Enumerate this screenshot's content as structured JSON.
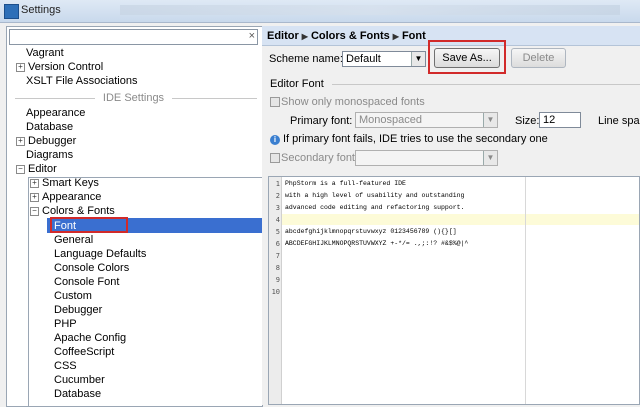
{
  "window": {
    "title": "Settings"
  },
  "search": {
    "clear_icon": "×"
  },
  "tree": {
    "top_items": [
      "Vagrant",
      "Version Control",
      "XSLT File Associations"
    ],
    "ide_section": "IDE Settings",
    "ide_items": [
      "Appearance",
      "Database",
      "Debugger",
      "Diagrams",
      "Editor"
    ],
    "editor_children": [
      "Smart Keys",
      "Appearance",
      "Colors & Fonts"
    ],
    "colors_children": [
      "Font",
      "General",
      "Language Defaults",
      "Console Colors",
      "Console Font",
      "Custom",
      "Debugger",
      "PHP",
      "Apache Config",
      "CoffeeScript",
      "CSS",
      "Cucumber",
      "Database"
    ]
  },
  "breadcrumb": [
    "Editor",
    "Colors & Fonts",
    "Font"
  ],
  "scheme": {
    "label": "Scheme name:",
    "value": "Default",
    "save_as": "Save As...",
    "delete": "Delete"
  },
  "editor_font": {
    "section": "Editor Font",
    "only_mono": "Show only monospaced fonts",
    "primary_label": "Primary font:",
    "primary_value": "Monospaced",
    "size_label": "Size:",
    "size_value": "12",
    "line_spacing": "Line spac",
    "fallback_note": "If primary font fails, IDE tries to use the secondary one",
    "secondary_label": "Secondary font:"
  },
  "preview": {
    "line_numbers": [
      "1",
      "2",
      "3",
      "4",
      "5",
      "6",
      "7",
      "8",
      "9",
      "10"
    ],
    "lines": [
      "PhpStorm is a full-featured IDE",
      "with a high level of usability and outstanding",
      "advanced code editing and refactoring support.",
      "",
      "abcdefghijklmnopqrstuvwxyz 0123456789 (){}[]",
      "ABCDEFGHIJKLMNOPQRSTUVWXYZ +-*/= .,;:!? #&$%@|^",
      "",
      "",
      "",
      ""
    ]
  }
}
